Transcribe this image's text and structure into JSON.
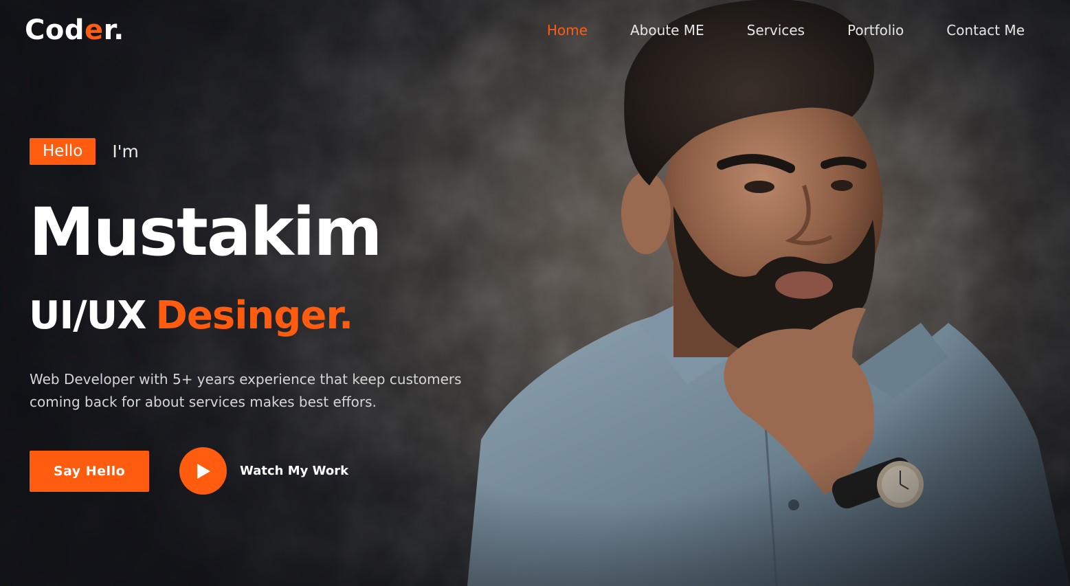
{
  "logo": {
    "text_main": "Cod",
    "text_accent": "e",
    "text_end": "r."
  },
  "nav": {
    "items": [
      {
        "label": "Home",
        "active": true
      },
      {
        "label": "Aboute ME",
        "active": false
      },
      {
        "label": "Services",
        "active": false
      },
      {
        "label": "Portfolio",
        "active": false
      },
      {
        "label": "Contact Me",
        "active": false
      }
    ]
  },
  "hero": {
    "badge": "Hello",
    "intro": "I'm",
    "name": "Mustakim",
    "role_part1": "UI/UX",
    "role_part2": "Desinger.",
    "description": "Web Developer with 5+ years experience that keep customers coming back for about services makes best effors.",
    "primary_button": "Say Hello",
    "video_link": "Watch My Work"
  },
  "colors": {
    "accent": "#ff5c0f",
    "text": "#ffffff",
    "background": "#2a2623"
  },
  "icons": [
    "play-icon"
  ]
}
